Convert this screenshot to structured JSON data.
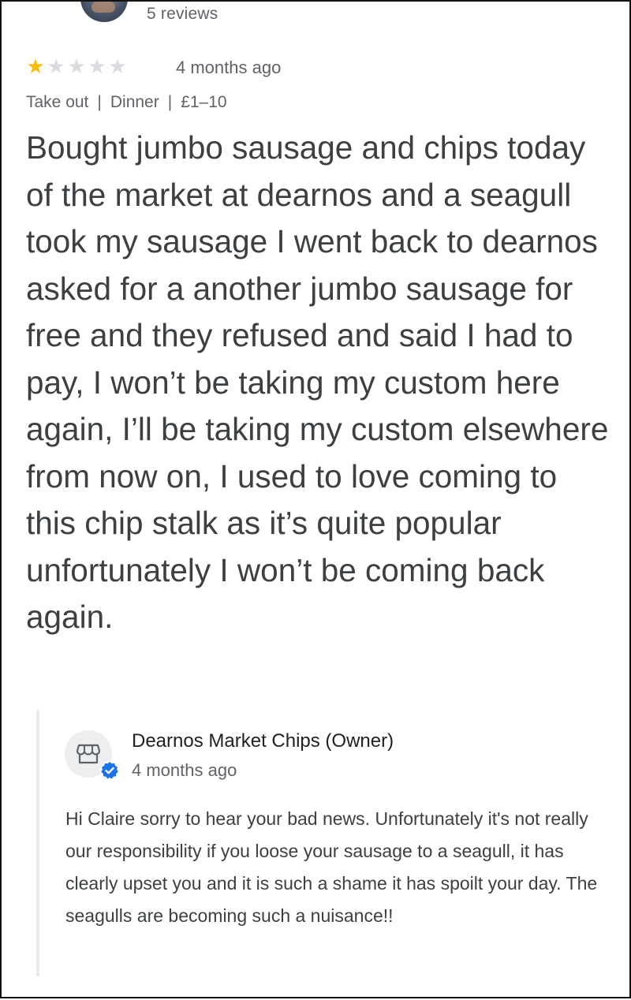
{
  "reviewer": {
    "review_count": "5 reviews"
  },
  "review": {
    "rating": 1,
    "max_rating": 5,
    "time": "4 months ago",
    "meta": {
      "service": "Take out",
      "meal": "Dinner",
      "price": "£1–10"
    },
    "text": "Bought jumbo sausage and chips today of the market at dearnos and a seagull took my sausage I went back to dearnos asked for a another jumbo sausage for free and they refused and said I had to pay, I won’t be taking my custom here again, I’ll be taking my custom elsewhere from now on, I used to love coming to this chip stalk as it’s quite popular unfortunately I won’t be coming back again."
  },
  "owner_reply": {
    "name": "Dearnos Market Chips (Owner)",
    "time": "4 months ago",
    "text": "Hi Claire sorry to hear your bad news. Unfortunately it's not really our responsibility if you loose your sausage to a seagull, it has clearly upset you and it is such a shame it has spoilt your day. The seagulls are becoming such a nuisance!!",
    "icon": "store-icon",
    "badge_icon": "verified-icon"
  },
  "colors": {
    "star_filled": "#fbbc04",
    "star_empty": "#dadce0",
    "verified_blue": "#1a73e8",
    "secondary_text": "#5f6368"
  }
}
